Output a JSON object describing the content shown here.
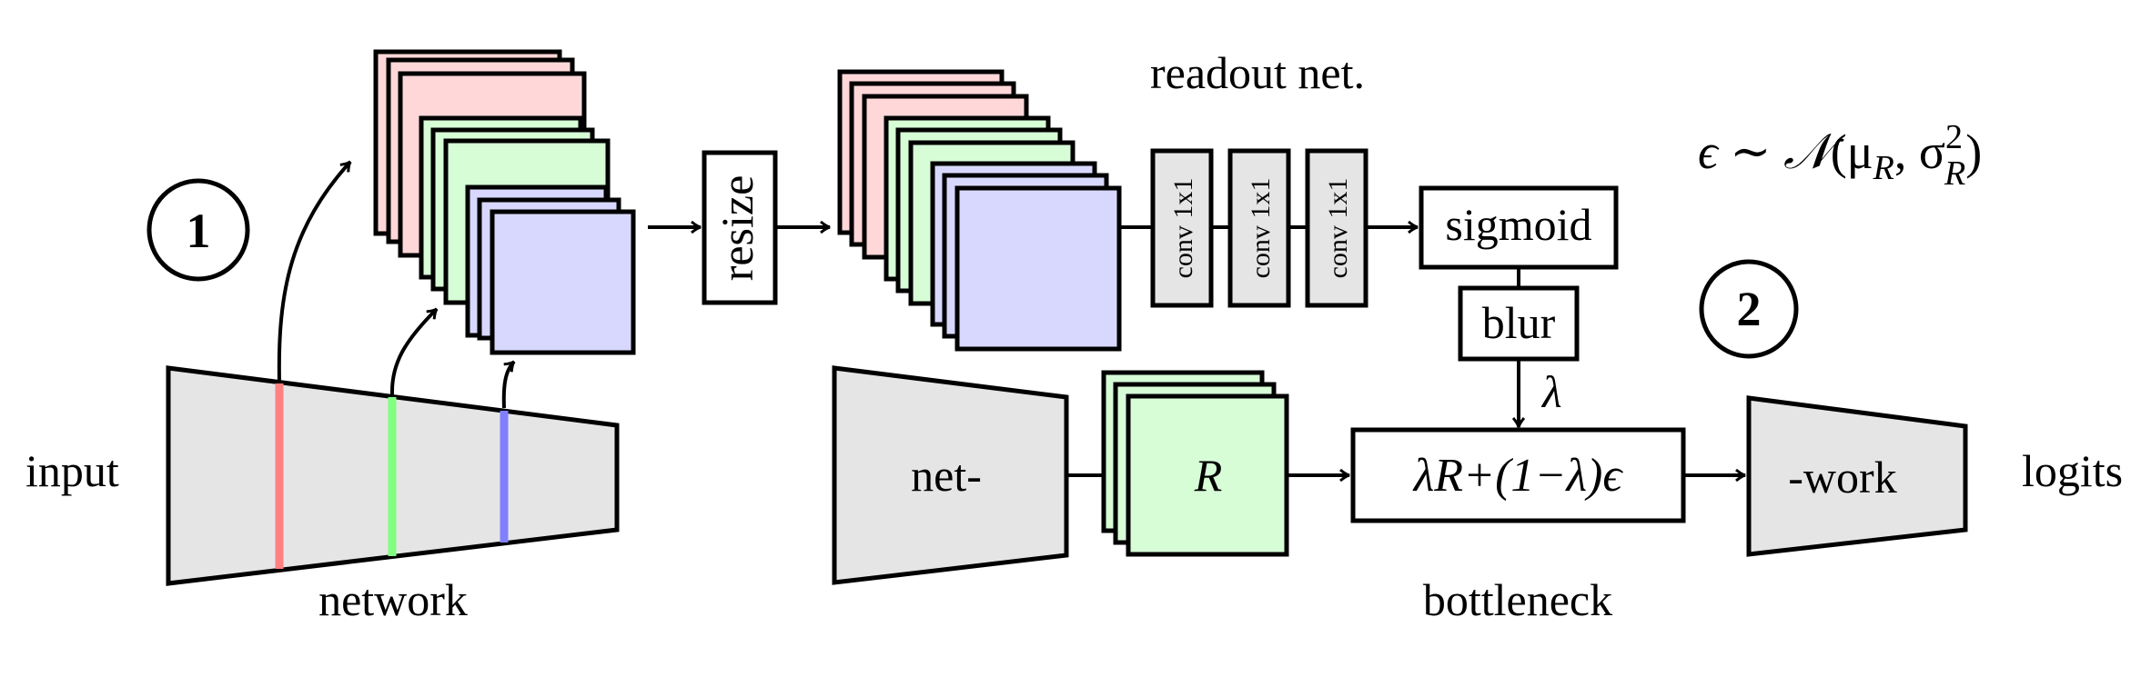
{
  "colors": {
    "layer_red_fill": "#ffd7d9",
    "layer_green_fill": "#d7fdd7",
    "layer_blue_fill": "#d8d8fe",
    "network_fill": "#e5e5e5",
    "tap_red": "#ff8080",
    "tap_green": "#80ff80",
    "tap_blue": "#8080ff",
    "stroke": "#000000",
    "box_fill": "#ffffff"
  },
  "labels": {
    "input": "input",
    "network": "network",
    "resize": "resize",
    "readout_net": "readout net.",
    "conv_1": "conv 1x1",
    "conv_2": "conv 1x1",
    "conv_3": "conv 1x1",
    "sigmoid": "sigmoid",
    "blur": "blur",
    "lambda": "λ",
    "net_part1": "net-",
    "feature_r": "R",
    "bottleneck_formula": "λR+(1−λ)ϵ",
    "bottleneck": "bottleneck",
    "net_part2": "-work",
    "logits": "logits",
    "noise_eps": "ϵ ∼ ",
    "noise_N": "𝒩",
    "noise_open": "(μ",
    "noise_sub_mu": "R",
    "noise_comma": ", σ",
    "noise_sub_sigma": "R",
    "noise_sup": "2",
    "noise_close": ")"
  },
  "steps": [
    {
      "number": "1"
    },
    {
      "number": "2"
    }
  ]
}
